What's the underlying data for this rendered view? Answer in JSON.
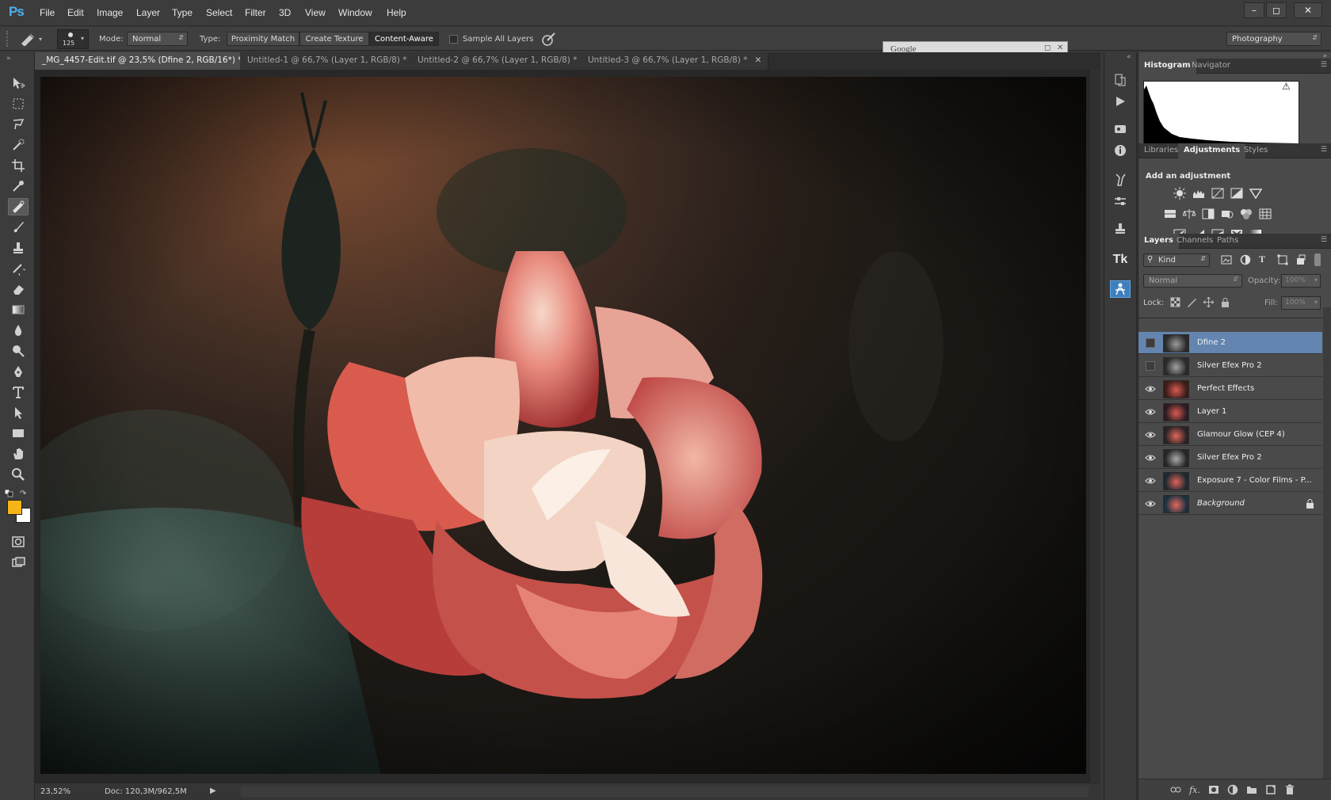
{
  "app": {
    "logo": "Ps"
  },
  "menu": [
    "File",
    "Edit",
    "Image",
    "Layer",
    "Type",
    "Select",
    "Filter",
    "3D",
    "View",
    "Window",
    "Help"
  ],
  "options": {
    "brush_size": "125",
    "mode_label": "Mode:",
    "mode_value": "Normal",
    "type_label": "Type:",
    "type_buttons": [
      "Proximity Match",
      "Create Texture",
      "Content-Aware"
    ],
    "sample_all_layers": "Sample All Layers",
    "workspace": "Photography"
  },
  "google_panel": {
    "title": "Google"
  },
  "tabs": [
    {
      "label": "_MG_4457-Edit.tif @ 23,5% (Dfine 2, RGB/16*) *",
      "active": true
    },
    {
      "label": "Untitled-1 @ 66,7% (Layer 1, RGB/8) *",
      "active": false
    },
    {
      "label": "Untitled-2 @ 66,7% (Layer 1, RGB/8) *",
      "active": false
    },
    {
      "label": "Untitled-3 @ 66,7% (Layer 1, RGB/8) *",
      "active": false
    }
  ],
  "tools": [
    "move-tool",
    "marquee-tool",
    "lasso-tool",
    "quick-selection-tool",
    "crop-tool",
    "eyedropper-tool",
    "spot-healing-tool",
    "brush-tool",
    "clone-stamp-tool",
    "history-brush-tool",
    "eraser-tool",
    "gradient-tool",
    "blur-tool",
    "dodge-tool",
    "pen-tool",
    "type-tool",
    "path-selection-tool",
    "rectangle-tool",
    "hand-tool",
    "zoom-tool"
  ],
  "colors": {
    "foreground": "#f5b516",
    "background": "#ffffff",
    "selection": "#6385b0",
    "accent": "#50b0f0"
  },
  "status": {
    "zoom": "23,52%",
    "doc": "Doc: 120,3M/962,5M"
  },
  "panels": {
    "histogram_tabs": [
      "Histogram",
      "Navigator"
    ],
    "adjust_tabs": [
      "Libraries",
      "Adjustments",
      "Styles"
    ],
    "adjust_title": "Add an adjustment",
    "layers_tabs": [
      "Layers",
      "Channels",
      "Paths"
    ],
    "kind_filter": "Kind",
    "blend_mode": "Normal",
    "opacity_label": "Opacity:",
    "opacity_value": "100%",
    "lock_label": "Lock:",
    "fill_label": "Fill:",
    "fill_value": "100%"
  },
  "layers": [
    {
      "name": "Dfine 2",
      "visible": false,
      "selected": true
    },
    {
      "name": "Silver Efex Pro 2",
      "visible": false,
      "selected": false
    },
    {
      "name": "Perfect Effects",
      "visible": true,
      "selected": false
    },
    {
      "name": "Layer 1",
      "visible": true,
      "selected": false
    },
    {
      "name": "Glamour Glow (CEP 4)",
      "visible": true,
      "selected": false
    },
    {
      "name": "Silver Efex Pro 2",
      "visible": true,
      "selected": false
    },
    {
      "name": "Exposure 7 - Color Films - P...",
      "visible": true,
      "selected": false
    },
    {
      "name": "Background",
      "visible": true,
      "selected": false,
      "locked": true
    }
  ]
}
